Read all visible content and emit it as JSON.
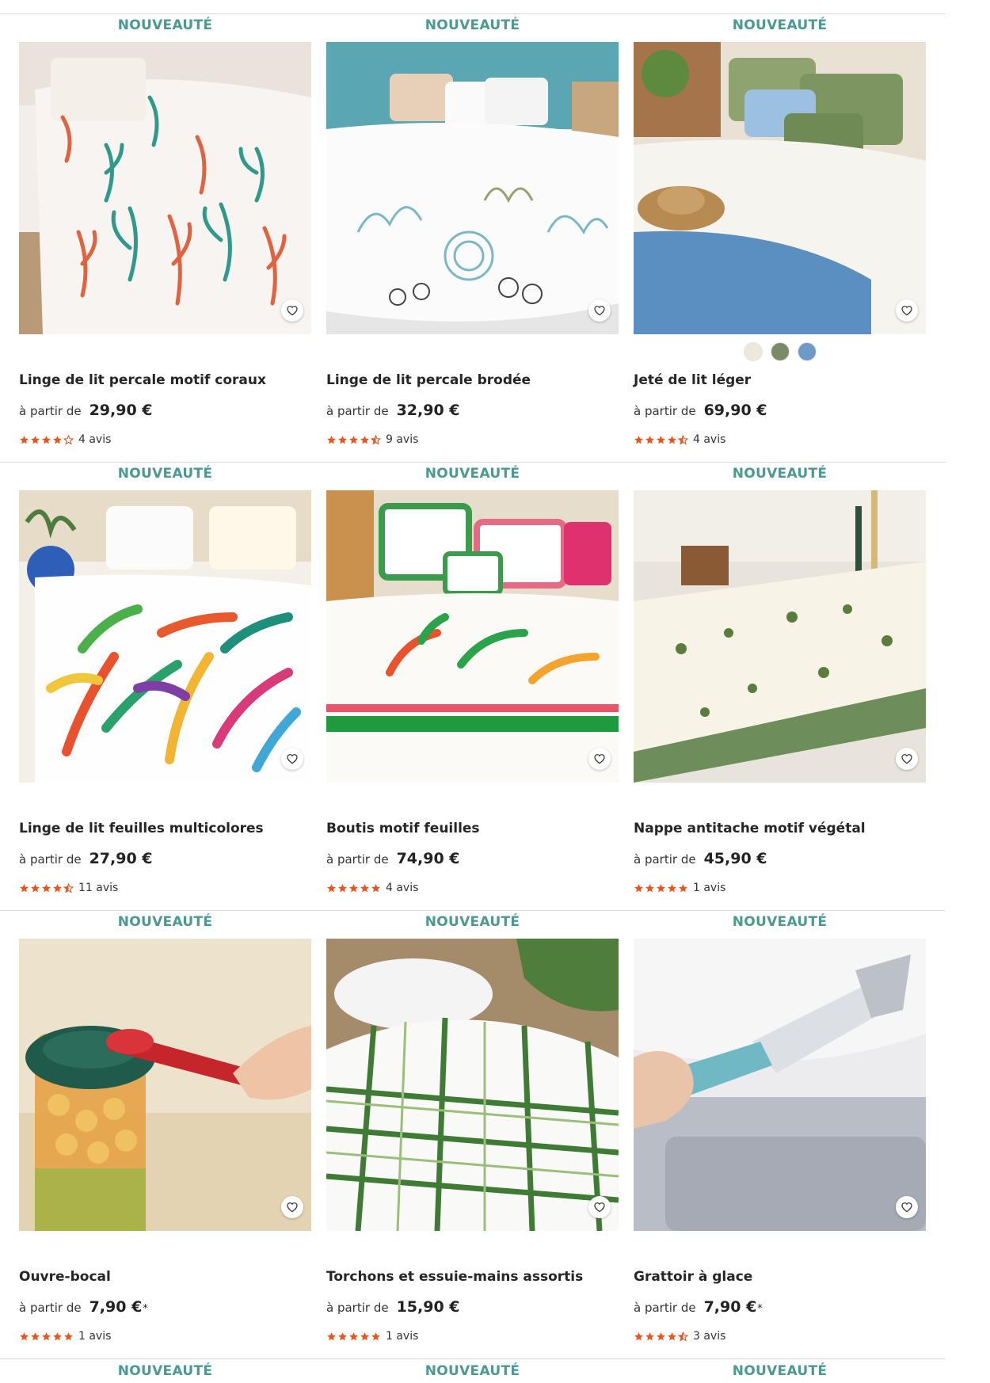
{
  "colors": {
    "badge": "#4a9a91",
    "star": "#e4571f",
    "divider": "#d9d9d9"
  },
  "products": [
    {
      "badge": "NOUVEAUTÉ",
      "title": "Linge de lit percale motif coraux",
      "price_prefix": "à partir de",
      "price": "29,90 €",
      "price_note": "",
      "rating": 4,
      "reviews": "4 avis",
      "swatches": [],
      "image": "bedding-coral-print",
      "icon": "heart-icon"
    },
    {
      "badge": "NOUVEAUTÉ",
      "title": "Linge de lit percale brodée",
      "price_prefix": "à partir de",
      "price": "32,90 €",
      "price_note": "",
      "rating": 4.5,
      "reviews": "9 avis",
      "swatches": [],
      "image": "bedding-embroidered-seashells",
      "icon": "heart-icon"
    },
    {
      "badge": "NOUVEAUTÉ",
      "title": "Jeté de lit léger",
      "price_prefix": "à partir de",
      "price": "69,90 €",
      "price_note": "",
      "rating": 4.5,
      "reviews": "4 avis",
      "swatches": [
        "#ece8dc",
        "#7a8c65",
        "#6f9ac7"
      ],
      "image": "light-bedspread",
      "icon": "heart-icon"
    },
    {
      "badge": "NOUVEAUTÉ",
      "title": "Linge de lit feuilles multicolores",
      "price_prefix": "à partir de",
      "price": "27,90 €",
      "price_note": "",
      "rating": 4.5,
      "reviews": "11 avis",
      "swatches": [],
      "image": "bedding-multicolor-leaves",
      "icon": "heart-icon"
    },
    {
      "badge": "NOUVEAUTÉ",
      "title": "Boutis motif feuilles",
      "price_prefix": "à partir de",
      "price": "74,90 €",
      "price_note": "",
      "rating": 5,
      "reviews": "4 avis",
      "swatches": [],
      "image": "quilt-leaf-pattern",
      "icon": "heart-icon"
    },
    {
      "badge": "NOUVEAUTÉ",
      "title": "Nappe antitache motif végétal",
      "price_prefix": "à partir de",
      "price": "45,90 €",
      "price_note": "",
      "rating": 5,
      "reviews": "1 avis",
      "swatches": [],
      "image": "tablecloth-plant-pattern",
      "icon": "heart-icon"
    },
    {
      "badge": "NOUVEAUTÉ",
      "title": "Ouvre-bocal",
      "price_prefix": "à partir de",
      "price": "7,90 €",
      "price_note": "*",
      "rating": 5,
      "reviews": "1 avis",
      "swatches": [],
      "image": "jar-opener",
      "icon": "heart-icon"
    },
    {
      "badge": "NOUVEAUTÉ",
      "title": "Torchons et essuie-mains assortis",
      "price_prefix": "à partir de",
      "price": "15,90 €",
      "price_note": "",
      "rating": 5,
      "reviews": "1 avis",
      "swatches": [],
      "image": "kitchen-towels",
      "icon": "heart-icon"
    },
    {
      "badge": "NOUVEAUTÉ",
      "title": "Grattoir à glace",
      "price_prefix": "à partir de",
      "price": "7,90 €",
      "price_note": "*",
      "rating": 4.5,
      "reviews": "3 avis",
      "swatches": [],
      "image": "ice-scraper",
      "icon": "heart-icon"
    }
  ],
  "next_row_badges": [
    "NOUVEAUTÉ",
    "NOUVEAUTÉ",
    "NOUVEAUTÉ"
  ]
}
